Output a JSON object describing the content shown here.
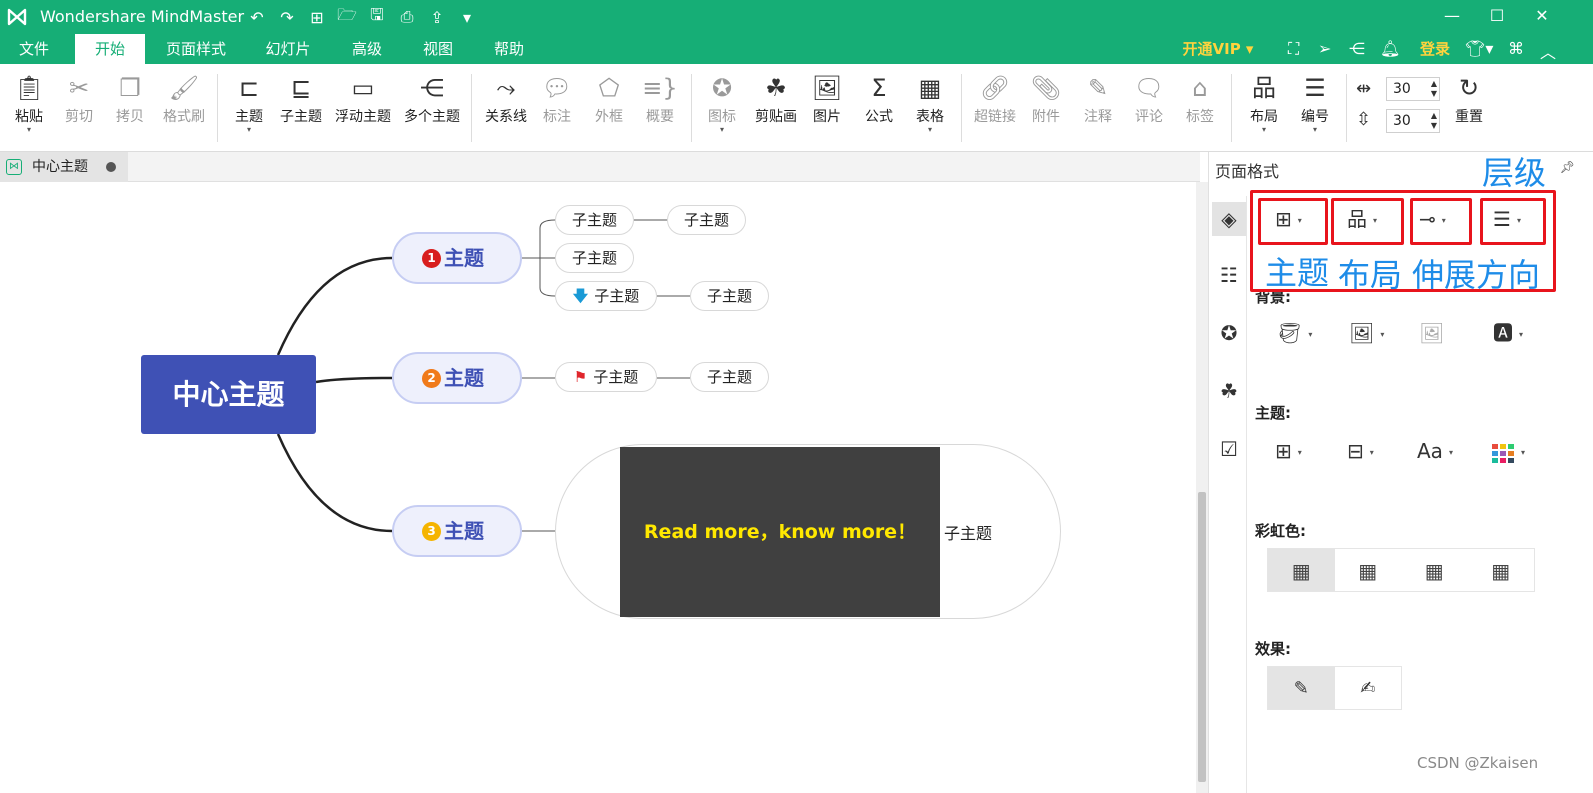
{
  "app": {
    "title": "Wondershare MindMaster"
  },
  "quick_access": [
    "↶",
    "↷",
    "⊞",
    "🗁",
    "🖫",
    "⎙",
    "⇪",
    "▾"
  ],
  "window_controls": {
    "minimize": "—",
    "maximize": "☐",
    "close": "✕"
  },
  "menu": {
    "tabs": [
      "文件",
      "开始",
      "页面样式",
      "幻灯片",
      "高级",
      "视图",
      "帮助"
    ],
    "active": "开始",
    "vip": "开通VIP",
    "login": "登录"
  },
  "ribbon": {
    "paste": "粘贴",
    "cut": "剪切",
    "copy": "拷贝",
    "format_painter": "格式刷",
    "topic": "主题",
    "subtopic": "子主题",
    "floating_topic": "浮动主题",
    "multi_topic": "多个主题",
    "relationship": "关系线",
    "callout": "标注",
    "boundary": "外框",
    "summary": "概要",
    "icon": "图标",
    "clipart": "剪贴画",
    "picture": "图片",
    "formula": "公式",
    "table": "表格",
    "hyperlink": "超链接",
    "attachment": "附件",
    "note": "注释",
    "comment": "评论",
    "tag": "标签",
    "layout": "布局",
    "numbering": "编号",
    "spacing_h": "30",
    "spacing_v": "30",
    "reset": "重置"
  },
  "doc_tab": {
    "label": "中心主题"
  },
  "mindmap": {
    "central": "中心主题",
    "topics": [
      {
        "label": "主题",
        "badge": "1",
        "badge_color": "#d81e1e",
        "subs": [
          {
            "label": "子主题",
            "child": "子主题"
          },
          {
            "label": "子主题"
          },
          {
            "label": "子主题",
            "icon": "arrow-down",
            "child": "子主题"
          }
        ]
      },
      {
        "label": "主题",
        "badge": "2",
        "badge_color": "#f07a1a",
        "subs": [
          {
            "label": "子主题",
            "icon": "flag",
            "child": "子主题"
          }
        ]
      },
      {
        "label": "主题",
        "badge": "3",
        "badge_color": "#f5b400",
        "image_text": "Read more，know more！",
        "sub": "子主题"
      }
    ]
  },
  "format_panel": {
    "title": "页面格式",
    "sections": {
      "background": "背景:",
      "theme": "主题:",
      "rainbow": "彩虹色:",
      "effect": "效果:"
    },
    "theme_font": "Aa"
  },
  "annotations": {
    "level": "层级",
    "theme": "主题",
    "layout": "布局",
    "direction": "伸展方向"
  },
  "watermark": "CSDN @Zkaisen",
  "colors": {
    "brand_green": "#16ae76",
    "central_blue": "#3f51b5",
    "annotation_red": "#e8141c",
    "annotation_blue": "#1e8ce8"
  }
}
